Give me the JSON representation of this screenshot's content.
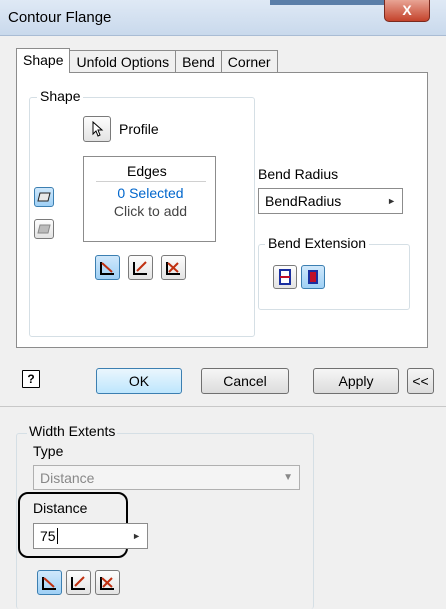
{
  "window": {
    "title": "Contour Flange",
    "close_glyph": "X"
  },
  "tabs": [
    {
      "label": "Shape",
      "active": true
    },
    {
      "label": "Unfold Options",
      "active": false
    },
    {
      "label": "Bend",
      "active": false
    },
    {
      "label": "Corner",
      "active": false
    }
  ],
  "shape": {
    "group_label": "Shape",
    "profile_label": "Profile",
    "edges": {
      "header": "Edges",
      "selected": "0 Selected",
      "hint": "Click to add"
    },
    "bend_radius": {
      "label": "Bend Radius",
      "value": "BendRadius"
    },
    "bend_extension": {
      "label": "Bend Extension"
    }
  },
  "buttons": {
    "ok": "OK",
    "cancel": "Cancel",
    "apply": "Apply",
    "more": "<<",
    "help": "?"
  },
  "width_extents": {
    "group_label": "Width Extents",
    "type_label": "Type",
    "type_value": "Distance",
    "distance_label": "Distance",
    "distance_value": "75"
  },
  "colors": {
    "highlight_text": "#0066cc",
    "callout_outline": "#000000",
    "pressed_icon_bg": "#9fd0f5"
  }
}
